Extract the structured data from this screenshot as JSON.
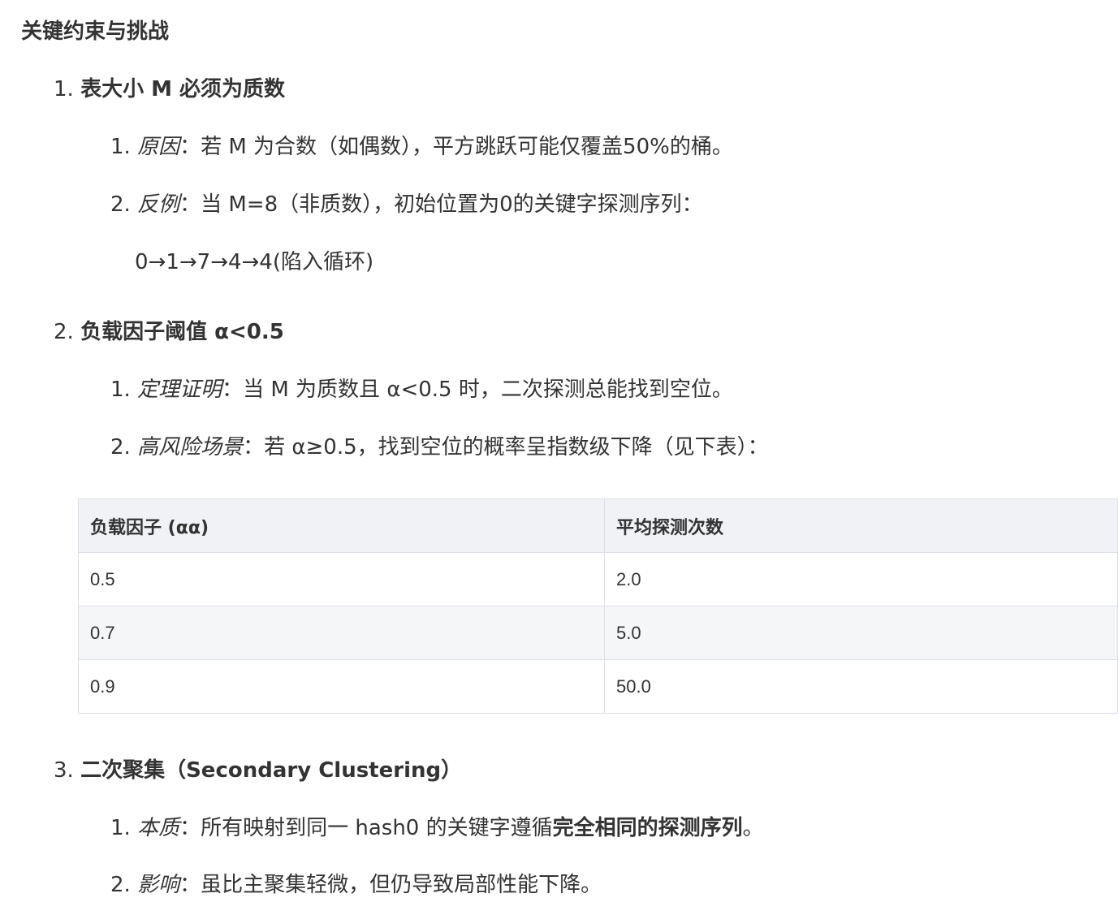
{
  "heading": "关键约束与挑战",
  "items": [
    {
      "num": "1.",
      "title": "表大小 M 必须为质数",
      "subs": [
        {
          "num": "1.",
          "label": "原因",
          "text": "：若 M 为合数（如偶数），平方跳跃可能仅覆盖50%的桶。"
        },
        {
          "num": "2.",
          "label": "反例",
          "text": "：当 M=8（非质数），初始位置为0的关键字探测序列：",
          "cont": "0→1→7→4→4(陷入循环)"
        }
      ]
    },
    {
      "num": "2.",
      "title": "负载因子阈值 α<0.5",
      "subs": [
        {
          "num": "1.",
          "label": "定理证明",
          "text": "：当 M 为质数且 α<0.5 时，二次探测总能找到空位。"
        },
        {
          "num": "2.",
          "label": "高风险场景",
          "text": "：若 α≥0.5，找到空位的概率呈指数级下降（见下表）："
        }
      ]
    },
    {
      "num": "3.",
      "title": "二次聚集（Secondary Clustering）",
      "subs": [
        {
          "num": "1.",
          "label": "本质",
          "text": "：所有映射到同一 hash0 的关键字遵循",
          "strong": "完全相同的探测序列",
          "tail": "。"
        },
        {
          "num": "2.",
          "label": "影响",
          "text": "：虽比主聚集轻微，但仍导致局部性能下降。"
        }
      ]
    }
  ],
  "table": {
    "headers": [
      "负载因子 (αα)",
      "平均探测次数"
    ],
    "rows": [
      [
        "0.5",
        "2.0"
      ],
      [
        "0.7",
        "5.0"
      ],
      [
        "0.9",
        "50.0"
      ]
    ]
  }
}
